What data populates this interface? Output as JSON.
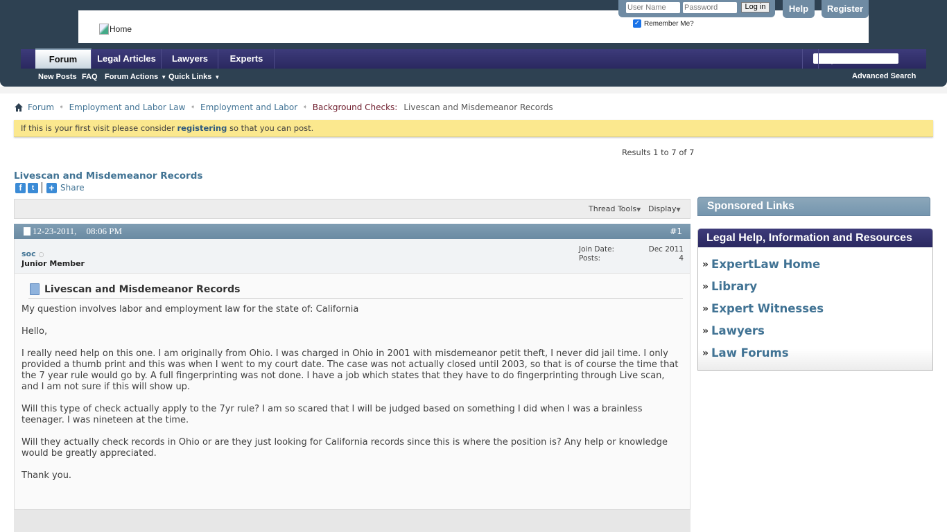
{
  "header": {
    "logo_alt": "Home",
    "login": {
      "username_placeholder": "User Name",
      "password_placeholder": "Password",
      "login_label": "Log in",
      "remember_label": "Remember Me?",
      "remember_checked": true
    },
    "help_label": "Help",
    "register_label": "Register"
  },
  "nav": {
    "tabs": [
      {
        "label": "Forum",
        "active": true
      },
      {
        "label": "Legal Articles",
        "active": false
      },
      {
        "label": "Lawyers",
        "active": false
      },
      {
        "label": "Experts",
        "active": false
      }
    ],
    "subnav": [
      {
        "label": "New Posts"
      },
      {
        "label": "FAQ"
      },
      {
        "label": "Forum Actions",
        "dropdown": true
      },
      {
        "label": "Quick Links",
        "dropdown": true
      }
    ],
    "search_placeholder": "",
    "advanced_search_label": "Advanced Search"
  },
  "breadcrumb": {
    "items": [
      "Forum",
      "Employment and Labor Law",
      "Employment and Labor"
    ],
    "current_prefix": "Background Checks:",
    "current": "Livescan and Misdemeanor Records"
  },
  "notice": {
    "before": "If this is your first visit please consider ",
    "link": "registering",
    "after": " so that you can post."
  },
  "results": "Results 1 to 7 of 7",
  "thread": {
    "title": "Livescan and Misdemeanor Records",
    "share_label": "Share",
    "tools": {
      "thread_tools": "Thread Tools",
      "display": "Display"
    }
  },
  "post": {
    "date": "12-23-2011,",
    "time": "08:06 PM",
    "number": "#1",
    "username": "soc",
    "user_title": "Junior Member",
    "join_date_label": "Join Date:",
    "join_date": "Dec 2011",
    "posts_label": "Posts:",
    "posts": "4",
    "title": "Livescan and Misdemeanor Records",
    "paragraphs": [
      "My question involves labor and employment law for the state of: California",
      "Hello,",
      "I really need help on this one. I am originally from Ohio. I was charged in Ohio in 2001 with misdemeanor petit theft, I never did jail time. I only provided a thumb print and this was when I went to my court date. The case was not actually closed until 2003, so that is of course the time that the 7 year rule would go by. A full fingerprinting was not done. I have a job which states that they have to do fingerprinting through Live scan, and I am not sure if this will show up.",
      "Will this type of check actually apply to the 7yr rule? I am so scared that I will be judged based on something I did when I was a brainless teenager. I was nineteen at the time.",
      "Will they actually check records in Ohio or are they just looking for California records since this is where the position is? Any help or knowledge would be greatly appreciated.",
      "Thank you."
    ]
  },
  "sidebar": {
    "sponsored_title": "Sponsored Links",
    "legal_title": "Legal Help, Information and Resources",
    "links": [
      "ExpertLaw Home",
      "Library",
      "Expert Witnesses",
      "Lawyers",
      "Law Forums"
    ]
  }
}
